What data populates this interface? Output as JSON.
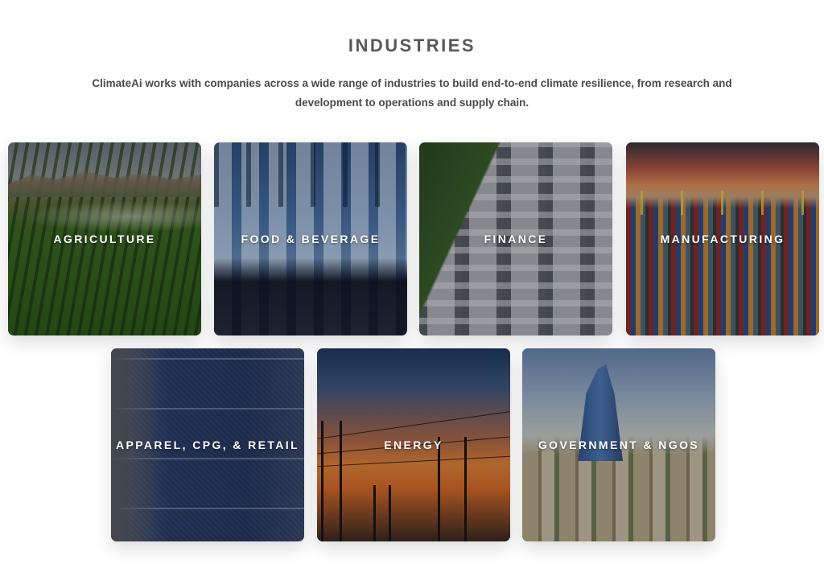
{
  "section": {
    "title": "INDUSTRIES",
    "intro": "ClimateAi works with companies across a wide range of industries to build end-to-end climate resilience, from research and development to operations and supply chain."
  },
  "industries": [
    {
      "label": "AGRICULTURE",
      "image": "crop-field-irrigation"
    },
    {
      "label": "FOOD & BEVERAGE",
      "image": "water-bottles-conveyor"
    },
    {
      "label": "FINANCE",
      "image": "aerial-housing-development"
    },
    {
      "label": "MANUFACTURING",
      "image": "shipping-container-port-sunset"
    },
    {
      "label": "APPAREL, CPG, & RETAIL",
      "image": "stacked-denim-jeans"
    },
    {
      "label": "ENERGY",
      "image": "power-transmission-towers-sunset"
    },
    {
      "label": "GOVERNMENT & NGOS",
      "image": "city-skyline-towers"
    }
  ],
  "colors": {
    "heading": "#585858",
    "body_text": "#4a4a4a",
    "card_label": "#ffffff",
    "background": "#ffffff"
  }
}
